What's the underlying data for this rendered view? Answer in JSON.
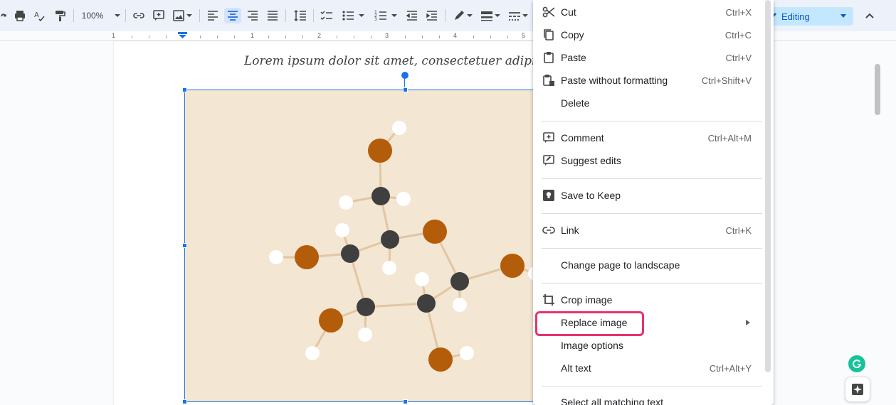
{
  "toolbar": {
    "zoom": "100%",
    "mode": "Editing"
  },
  "ruler": {
    "ticks": [
      "1",
      "1",
      "2",
      "3",
      "4",
      "5"
    ]
  },
  "document": {
    "text": "Lorem ipsum dolor sit amet, consectetuer adipiscing"
  },
  "context_menu": {
    "cut": {
      "label": "Cut",
      "shortcut": "Ctrl+X"
    },
    "copy": {
      "label": "Copy",
      "shortcut": "Ctrl+C"
    },
    "paste": {
      "label": "Paste",
      "shortcut": "Ctrl+V"
    },
    "paste_plain": {
      "label": "Paste without formatting",
      "shortcut": "Ctrl+Shift+V"
    },
    "delete": {
      "label": "Delete"
    },
    "comment": {
      "label": "Comment",
      "shortcut": "Ctrl+Alt+M"
    },
    "suggest": {
      "label": "Suggest edits"
    },
    "keep": {
      "label": "Save to Keep"
    },
    "link": {
      "label": "Link",
      "shortcut": "Ctrl+K"
    },
    "landscape": {
      "label": "Change page to landscape"
    },
    "crop": {
      "label": "Crop image"
    },
    "replace": {
      "label": "Replace image"
    },
    "options": {
      "label": "Image options"
    },
    "alt": {
      "label": "Alt text",
      "shortcut": "Ctrl+Alt+Y"
    },
    "select_all": {
      "label": "Select all matching text"
    }
  },
  "colors": {
    "accent": "#1a73e8",
    "highlight": "#e8336d",
    "image_bg": "#f3e6d2",
    "oxygen_atom": "#b35c0a",
    "carbon_atom": "#3f3f3f",
    "grammarly": "#15c39a"
  }
}
